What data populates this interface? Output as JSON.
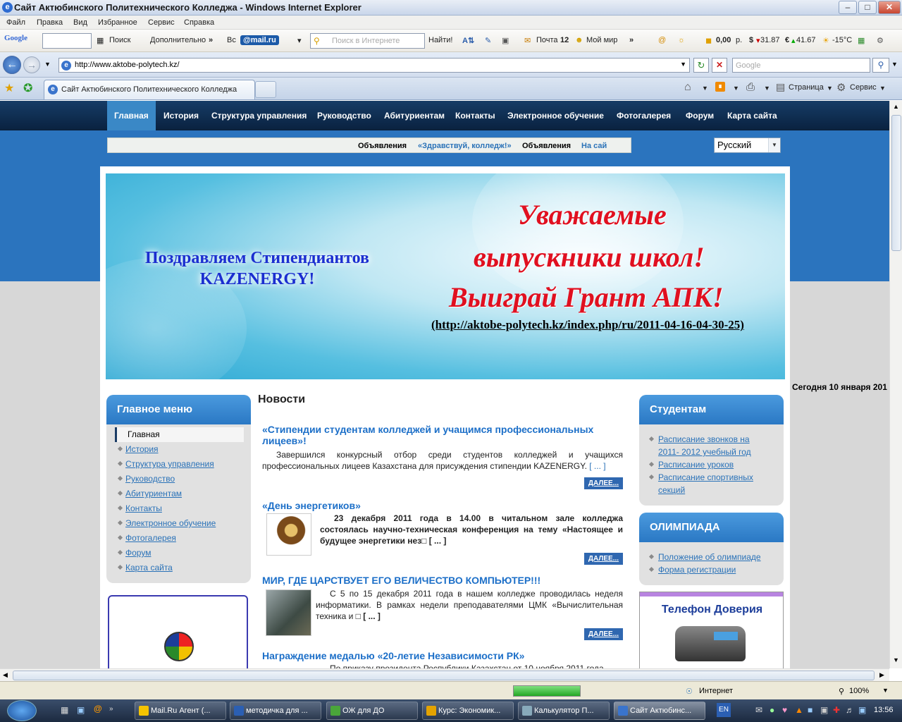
{
  "window": {
    "title": "Сайт Актюбинского Политехнического Колледжа - Windows Internet Explorer"
  },
  "menubar": [
    "Файл",
    "Правка",
    "Вид",
    "Избранное",
    "Сервис",
    "Справка"
  ],
  "toolbar": {
    "google": "Google",
    "search": "Поиск",
    "more": "Дополнительно",
    "vk": "Вс",
    "mail": "@mail.ru",
    "search_placeholder": "Поиск в Интернете",
    "find": "Найти!",
    "mail_label": "Почта",
    "mail_count": "12",
    "myworld": "Мой мир",
    "balance": "0,00",
    "balance_unit": "р.",
    "usd": "31.87",
    "eur": "41.67",
    "temp": "-15°C"
  },
  "address": {
    "url": "http://www.aktobe-polytech.kz/",
    "search_placeholder": "Google"
  },
  "tab": {
    "label": "Сайт Актюбинского Политехнического Колледжа"
  },
  "cmdbar": {
    "page": "Страница",
    "tools": "Сервис"
  },
  "site": {
    "nav": [
      "Главная",
      "История",
      "Структура управления",
      "Руководство",
      "Абитуриентам",
      "Контакты",
      "Электронное обучение",
      "Фотогалерея",
      "Форум",
      "Карта сайта"
    ],
    "ticker": [
      "Объявления",
      "«Здравствуй, колледж!»",
      "Объявления",
      "На сай"
    ],
    "language": "Русский",
    "banner": {
      "congrats": "Поздравляем Стипендиантов KAZENERGY!",
      "line1": "Уважаемые",
      "line2": "выпускники школ!",
      "line3": "Выиграй Грант АПК!",
      "url": "(http://aktobe-polytech.kz/index.php/ru/2011-04-16-04-30-25)"
    },
    "today": "Сегодня 10 января 201",
    "main_menu": {
      "title": "Главное меню",
      "items": [
        "Главная",
        "История",
        "Структура управления",
        "Руководство",
        "Абитуриентам",
        "Контакты",
        "Электронное обучение",
        "Фотогалерея",
        "Форум",
        "Карта сайта"
      ]
    },
    "news": {
      "heading": "Новости",
      "more": "ДАЛЕЕ...",
      "items": [
        {
          "title": "«Стипендии студентам колледжей и учащимся профессиональных лицеев»!",
          "body": "Завершился конкурсный отбор среди студентов колледжей и учащихся профессиональных лицеев Казахстана для присуждения стипендии KAZENERGY.",
          "tail": "[ ... ]"
        },
        {
          "title": "«День энергетиков»",
          "body": "23 декабря 2011 года в 14.00 в читальном зале колледжа состоялась научно-техническая конференция на тему «Настоящее и будущее энергетики нез□",
          "tail": "[ ... ]"
        },
        {
          "title": "МИР, ГДЕ ЦАРСТВУЕТ ЕГО ВЕЛИЧЕСТВО КОМПЬЮТЕР!!!",
          "body": "С 5 по 15 декабря 2011 года в нашем колледже проводилась неделя информатики. В рамках недели преподавателями ЦМК «Вычислительная техника и □",
          "tail": "[ ... ]"
        },
        {
          "title": "Награждение медалью «20-летие Независимости РК»",
          "body": "По приказу президента Республики Казахстан от 10 ноября 2011 года",
          "tail": ""
        }
      ]
    },
    "students": {
      "title": "Студентам",
      "links": [
        "Расписание звонков на 2011- 2012 учебный год",
        "Расписание уроков",
        "Расписание спортивных секций"
      ]
    },
    "olympiad": {
      "title": "ОЛИМПИАДА",
      "links": [
        "Положение об олимпиаде",
        "Форма регистрации"
      ]
    },
    "hotline": {
      "title": "Телефон Доверия"
    }
  },
  "status": {
    "zone": "Интернет",
    "zoom": "100%"
  },
  "taskbar": {
    "tasks": [
      "Mail.Ru Агент (...",
      "методичка для ...",
      "ОЖ  для ДО",
      "Курс: Экономик...",
      "Калькулятор П...",
      "Сайт Актюбинс..."
    ],
    "lang": "EN",
    "clock": "13:56"
  }
}
